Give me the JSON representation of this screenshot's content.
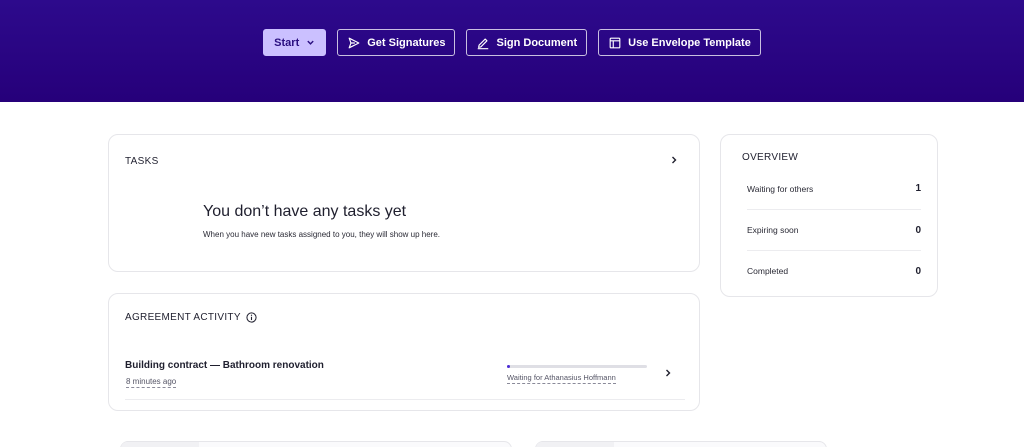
{
  "hero": {
    "buttons": {
      "start": "Start",
      "get_signatures": "Get Signatures",
      "sign_document": "Sign Document",
      "use_template": "Use Envelope Template"
    }
  },
  "tasks": {
    "title": "TASKS",
    "empty_title": "You don’t have any tasks yet",
    "empty_subtitle": "When you have new tasks assigned to you, they will show up here."
  },
  "activity": {
    "title": "AGREEMENT ACTIVITY",
    "rows": [
      {
        "title": "Building contract — Bathroom renovation",
        "time": "8 minutes ago",
        "status": "Waiting for Athanasius Hoffmann",
        "progress": 0.02
      }
    ]
  },
  "overview": {
    "title": "OVERVIEW",
    "items": [
      {
        "label": "Waiting for others",
        "value": "1"
      },
      {
        "label": "Expiring soon",
        "value": "0"
      },
      {
        "label": "Completed",
        "value": "0"
      }
    ]
  },
  "colors": {
    "hero_bg": "#2d0a8c",
    "start_button_bg": "#cbc0ff",
    "progress_fill": "#4b2bd6"
  }
}
